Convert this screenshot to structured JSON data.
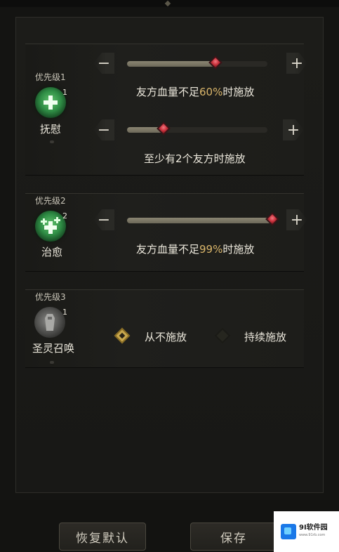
{
  "priorities": [
    {
      "label": "优先级1",
      "skill": {
        "name": "抚慰",
        "count": "1",
        "icon": "heal-cross-icon"
      },
      "sliders": [
        {
          "value_pct": 60,
          "text_before": "友方血量不足",
          "value_text": "60%",
          "text_after": "时施放"
        },
        {
          "value_pct": 25,
          "text_before": "至少有",
          "value_text": "2",
          "text_after": "个友方时施放"
        }
      ]
    },
    {
      "label": "优先级2",
      "skill": {
        "name": "治愈",
        "count": "2",
        "icon": "multi-heal-cross-icon"
      },
      "sliders": [
        {
          "value_pct": 99,
          "text_before": "友方血量不足",
          "value_text": "99%",
          "text_after": "时施放"
        }
      ]
    },
    {
      "label": "优先级3",
      "skill": {
        "name": "圣灵召唤",
        "count": "1",
        "icon": "summon-statue-icon"
      },
      "options": [
        {
          "label": "从不施放",
          "checked": true
        },
        {
          "label": "持续施放",
          "checked": false
        }
      ]
    }
  ],
  "controls": {
    "minus": "−",
    "plus": "+"
  },
  "buttons": {
    "reset": "恢复默认",
    "save": "保存"
  },
  "watermark": {
    "title": "9I软件园",
    "subtitle": "www.91rb.com"
  },
  "colors": {
    "accent": "#d9b56a",
    "knob": "#c8303b",
    "checkbox": "#c9a84e"
  }
}
